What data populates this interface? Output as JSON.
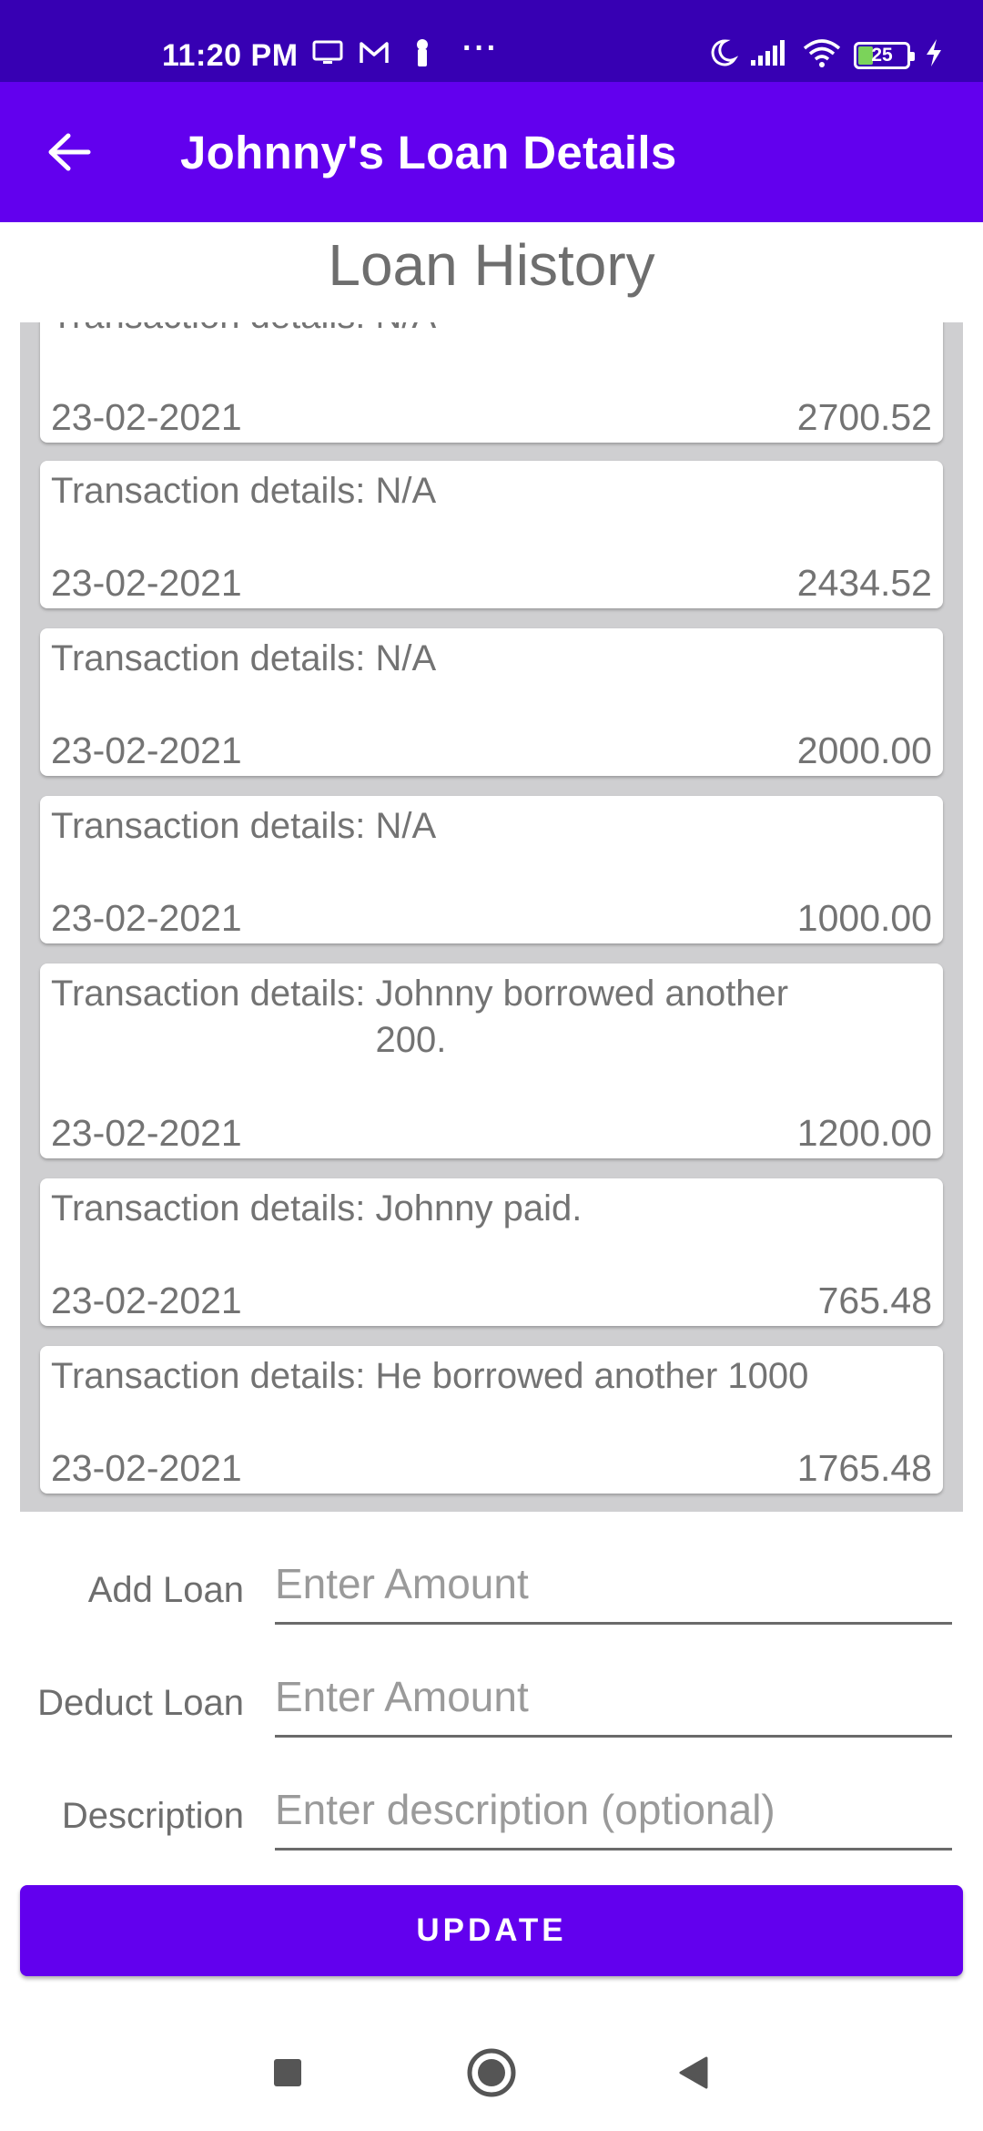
{
  "status_bar": {
    "time": "11:20 PM",
    "icons": [
      "monitor-icon",
      "gmail-icon",
      "notification-icon",
      "more-icon",
      "moon-icon",
      "signal-icon",
      "wifi-icon",
      "battery-icon",
      "charging-icon"
    ],
    "more": "···",
    "battery": "25",
    "background": "#3700b3"
  },
  "app_bar": {
    "back_icon": "arrow-left-icon",
    "title": "Johnny's Loan Details",
    "background": "#6200ee"
  },
  "history": {
    "title": "Loan History",
    "label": "Transaction details:",
    "items": [
      {
        "details": "N/A",
        "date": "23-02-2021",
        "amount": "2700.52"
      },
      {
        "details": "N/A",
        "date": "23-02-2021",
        "amount": "2434.52"
      },
      {
        "details": "N/A",
        "date": "23-02-2021",
        "amount": "2000.00"
      },
      {
        "details": "N/A",
        "date": "23-02-2021",
        "amount": "1000.00"
      },
      {
        "details": "Johnny borrowed another 200.",
        "date": "23-02-2021",
        "amount": "1200.00"
      },
      {
        "details": "Johnny paid.",
        "date": "23-02-2021",
        "amount": "765.48"
      },
      {
        "details": "He borrowed another 1000",
        "date": "23-02-2021",
        "amount": "1765.48"
      }
    ]
  },
  "form": {
    "add_loan": {
      "label": "Add Loan",
      "placeholder": "Enter Amount"
    },
    "deduct_loan": {
      "label": "Deduct Loan",
      "placeholder": "Enter Amount"
    },
    "description": {
      "label": "Description",
      "placeholder": "Enter description (optional)"
    }
  },
  "update_button": "UPDATE",
  "nav_bar": {
    "icons": [
      "recents-square-icon",
      "home-circle-icon",
      "back-triangle-icon"
    ]
  }
}
